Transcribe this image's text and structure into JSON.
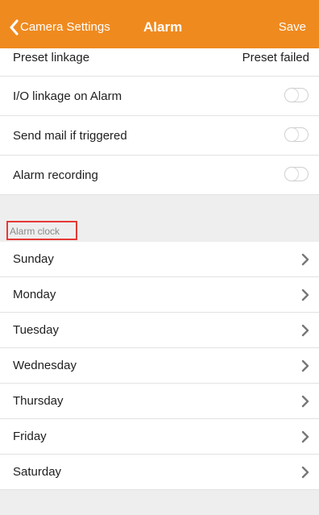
{
  "header": {
    "back_label": "Camera Settings",
    "title": "Alarm",
    "save_label": "Save",
    "color": "#ef8a1f"
  },
  "settings": {
    "preset_linkage": {
      "label": "Preset linkage",
      "value": "Preset failed"
    },
    "toggles": [
      {
        "label": "I/O linkage on Alarm",
        "on": false
      },
      {
        "label": "Send mail if triggered",
        "on": false
      },
      {
        "label": "Alarm recording",
        "on": false
      }
    ]
  },
  "alarm_clock": {
    "section_title": "Alarm clock",
    "days": [
      "Sunday",
      "Monday",
      "Tuesday",
      "Wednesday",
      "Thursday",
      "Friday",
      "Saturday"
    ]
  },
  "icons": {
    "back": "chevron-left-icon",
    "row_arrow": "chevron-right-icon"
  }
}
